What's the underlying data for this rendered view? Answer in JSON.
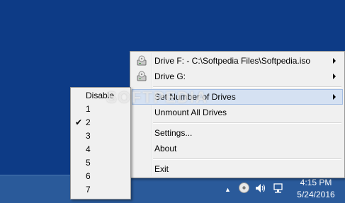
{
  "menu": {
    "items": [
      {
        "label": "Drive F: - C:\\Softpedia Files\\Softpedia.iso",
        "icon": "drive-icon",
        "submenu": true
      },
      {
        "label": "Drive G:",
        "icon": "drive-icon",
        "submenu": true
      },
      {
        "label": "Set Number of Drives",
        "submenu": true,
        "highlighted": true
      },
      {
        "label": "Unmount All Drives"
      },
      {
        "label": "Settings..."
      },
      {
        "label": "About"
      },
      {
        "label": "Exit"
      }
    ]
  },
  "submenu": {
    "items": [
      "Disable",
      "1",
      "2",
      "3",
      "4",
      "5",
      "6",
      "7"
    ],
    "checked": "2"
  },
  "watermark": "SOFTPEDIA",
  "clock": {
    "time": "4:15 PM",
    "date": "5/24/2016"
  },
  "colors": {
    "desktop": "#0d3b86",
    "taskbar": "#2a5a9a",
    "highlight": "#d5e1f2"
  }
}
